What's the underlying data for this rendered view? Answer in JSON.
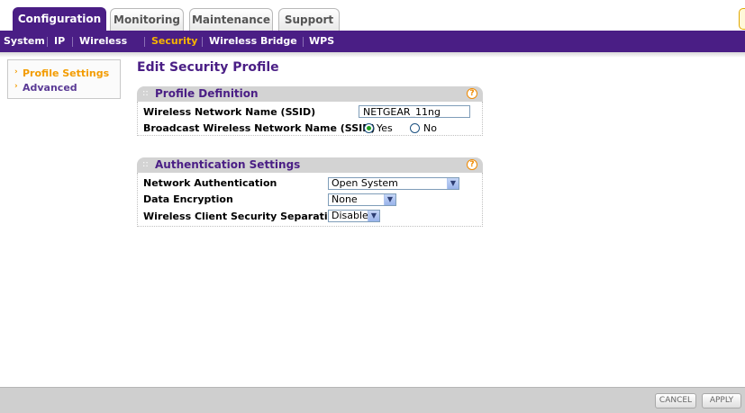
{
  "tabs": [
    {
      "label": "Configuration",
      "active": true
    },
    {
      "label": "Monitoring",
      "active": false
    },
    {
      "label": "Maintenance",
      "active": false
    },
    {
      "label": "Support",
      "active": false
    }
  ],
  "subnav": [
    {
      "label": "System",
      "active": false
    },
    {
      "label": "IP",
      "active": false
    },
    {
      "label": "Wireless",
      "active": false
    },
    {
      "label": "Security",
      "active": true
    },
    {
      "label": "Wireless Bridge",
      "active": false
    },
    {
      "label": "WPS",
      "active": false
    }
  ],
  "sidebar": {
    "items": [
      {
        "label": "Profile Settings",
        "active": true
      },
      {
        "label": "Advanced",
        "active": false
      }
    ]
  },
  "page_title": "Edit Security Profile",
  "profile_definition": {
    "title": "Profile Definition",
    "ssid_label": "Wireless Network Name (SSID)",
    "ssid_value": "NETGEAR_11ng",
    "broadcast_label": "Broadcast Wireless Network Name (SSID)",
    "yes_label": "Yes",
    "no_label": "No",
    "broadcast_selected": "Yes"
  },
  "authentication": {
    "title": "Authentication Settings",
    "network_auth_label": "Network Authentication",
    "network_auth_value": "Open System",
    "data_encryption_label": "Data Encryption",
    "data_encryption_value": "None",
    "separation_label": "Wireless Client Security Separation",
    "separation_value": "Disable"
  },
  "help_glyph": "?",
  "footer": {
    "cancel_label": "CANCEL",
    "apply_label": "APPLY"
  },
  "colors": {
    "brand_purple": "#4a1e85",
    "accent_orange": "#f39c00"
  }
}
